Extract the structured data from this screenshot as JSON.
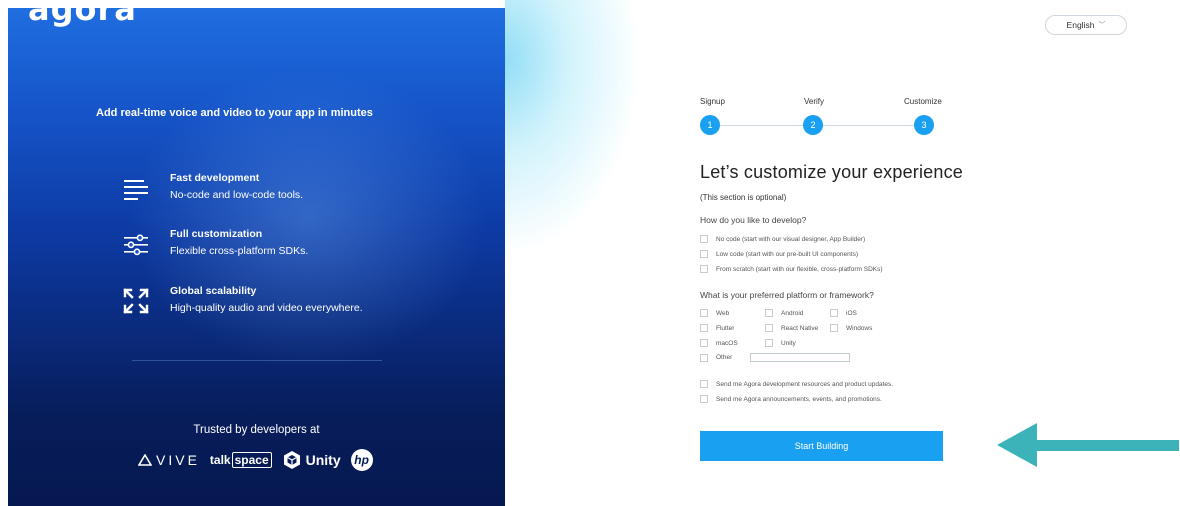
{
  "left": {
    "logo_text": "agora",
    "tagline": "Add real-time voice and video to your app in minutes",
    "features": [
      {
        "icon": "lines-icon",
        "title": "Fast development",
        "desc": "No-code and low-code tools."
      },
      {
        "icon": "sliders-icon",
        "title": "Full customization",
        "desc": "Flexible cross-platform SDKs."
      },
      {
        "icon": "expand-arrows-icon",
        "title": "Global scalability",
        "desc": "High-quality audio and video everywhere."
      }
    ],
    "trusted": "Trusted by developers at",
    "brands": {
      "vive": "VIVE",
      "talk": "talk",
      "space": "space",
      "unity": "Unity",
      "hp": "hp"
    }
  },
  "header": {
    "language": "English"
  },
  "stepper": {
    "steps": [
      {
        "label": "Signup",
        "number": "1"
      },
      {
        "label": "Verify",
        "number": "2"
      },
      {
        "label": "Customize",
        "number": "3"
      }
    ]
  },
  "form": {
    "heading": "Let’s customize your experience",
    "optional": "(This section is optional)",
    "q1": "How do you like to develop?",
    "q1_options": [
      "No code (start with our visual designer, App Builder)",
      "Low code (start with our pre-built UI components)",
      "From scratch (start with our flexible, cross-platform SDKs)"
    ],
    "q2": "What is your preferred platform or framework?",
    "platforms": [
      "Web",
      "Android",
      "iOS",
      "Flutter",
      "React Native",
      "Windows",
      "macOS",
      "Unity",
      "Other"
    ],
    "other_value": "",
    "consent": [
      "Send me Agora development resources and product updates.",
      "Send me Agora announcements, events, and promotions."
    ],
    "submit": "Start Building"
  },
  "colors": {
    "accent": "#1aa0f0",
    "arrow": "#3bb3b8",
    "panel_dark": "#071d5a"
  }
}
